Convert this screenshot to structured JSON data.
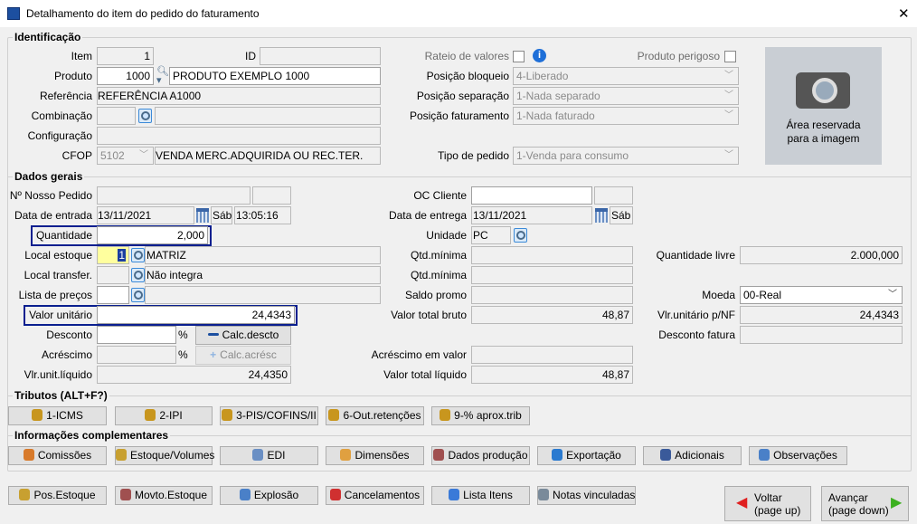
{
  "window": {
    "title": "Detalhamento do item do pedido do faturamento",
    "close": "✕"
  },
  "identificacao": {
    "title": "Identificação",
    "item_label": "Item",
    "item_value": "1",
    "id_label": "ID",
    "id_value": "",
    "produto_label": "Produto",
    "produto_code": "1000",
    "produto_name": "PRODUTO EXEMPLO 1000",
    "referencia_label": "Referência",
    "referencia_value": "REFERÊNCIA A1000",
    "combinacao_label": "Combinação",
    "combinacao_value": "",
    "combinacao_desc": "",
    "configuracao_label": "Configuração",
    "configuracao_value": "",
    "cfop_label": "CFOP",
    "cfop_value": "5102",
    "cfop_desc": "VENDA MERC.ADQUIRIDA OU REC.TER.",
    "rateio_label": "Rateio de valores",
    "produto_perigoso_label": "Produto perigoso",
    "posicao_bloqueio_label": "Posição bloqueio",
    "posicao_bloqueio_value": "4-Liberado",
    "posicao_separacao_label": "Posição separação",
    "posicao_separacao_value": "1-Nada separado",
    "posicao_faturamento_label": "Posição faturamento",
    "posicao_faturamento_value": "1-Nada faturado",
    "tipo_pedido_label": "Tipo de pedido",
    "tipo_pedido_value": "1-Venda para consumo",
    "image_text_1": "Área reservada",
    "image_text_2": "para a imagem"
  },
  "dados_gerais": {
    "title": "Dados gerais",
    "nosso_pedido_label": "Nº Nosso Pedido",
    "data_entrada_label": "Data de entrada",
    "data_entrada_value": "13/11/2021",
    "data_entrada_day": "Sáb",
    "data_entrada_time": "13:05:16",
    "quantidade_label": "Quantidade",
    "quantidade_value": "2,000",
    "local_estoque_label": "Local estoque",
    "local_estoque_code": "1",
    "local_estoque_name": "MATRIZ",
    "local_transfer_label": "Local transfer.",
    "local_transfer_name": "Não integra",
    "lista_precos_label": "Lista de preços",
    "valor_unitario_label": "Valor unitário",
    "valor_unitario_value": "24,4343",
    "desconto_label": "Desconto",
    "percent": "%",
    "calc_desconto": "Calc.descto",
    "acrescimo_label": "Acréscimo",
    "calc_acrescimo": "Calc.acrésc",
    "vlr_unit_liquido_label": "Vlr.unit.líquido",
    "vlr_unit_liquido_value": "24,4350",
    "oc_cliente_label": "OC Cliente",
    "data_entrega_label": "Data de entrega",
    "data_entrega_value": "13/11/2021",
    "data_entrega_day": "Sáb",
    "unidade_label": "Unidade",
    "unidade_value": "PC",
    "qtd_minima_label": "Qtd.mínima",
    "qtd_minima2_label": "Qtd.mínima",
    "saldo_promo_label": "Saldo promo",
    "valor_total_bruto_label": "Valor total bruto",
    "valor_total_bruto_value": "48,87",
    "acrescimo_valor_label": "Acréscimo em valor",
    "valor_total_liquido_label": "Valor total líquido",
    "valor_total_liquido_value": "48,87",
    "quantidade_livre_label": "Quantidade livre",
    "quantidade_livre_value": "2.000,000",
    "moeda_label": "Moeda",
    "moeda_value": "00-Real",
    "vlr_unit_nf_label": "Vlr.unitário p/NF",
    "vlr_unit_nf_value": "24,4343",
    "desconto_fatura_label": "Desconto fatura"
  },
  "tributos": {
    "title": "Tributos (ALT+F?)",
    "buttons": [
      "1-ICMS",
      "2-IPI",
      "3-PIS/COFINS/II",
      "6-Out.retenções",
      "9-% aprox.trib"
    ]
  },
  "info": {
    "title": "Informações complementares",
    "buttons": [
      "Comissões",
      "Estoque/Volumes",
      "EDI",
      "Dimensões",
      "Dados produção",
      "Exportação",
      "Adicionais",
      "Observações"
    ]
  },
  "bottom": {
    "buttons": [
      "Pos.Estoque",
      "Movto.Estoque",
      "Explosão",
      "Cancelamentos",
      "Lista Itens",
      "Notas vinculadas"
    ],
    "voltar": "Voltar",
    "voltar_hint": "(page up)",
    "avancar": "Avançar",
    "avancar_hint": "(page down)"
  },
  "colors": {
    "highlight": "#0a1f8f",
    "yellow_field": "#ffff9e",
    "title_icon": "#1c4fa0"
  }
}
